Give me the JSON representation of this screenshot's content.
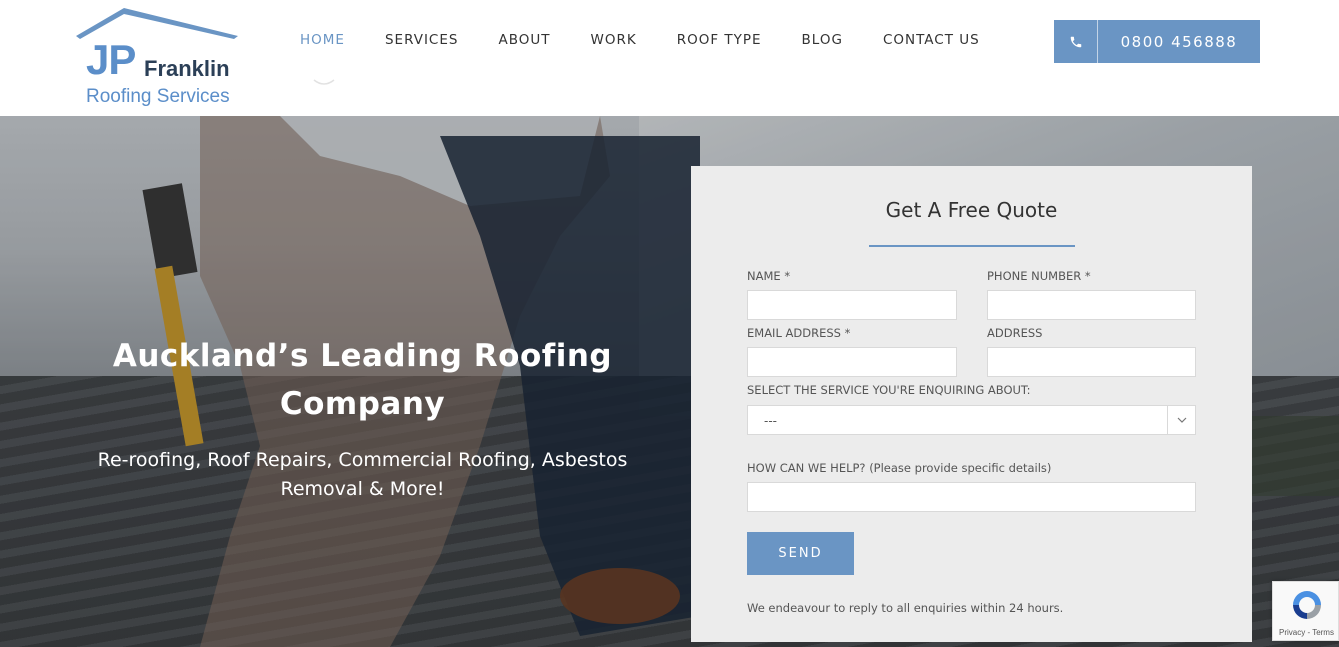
{
  "brand": {
    "logo_initials": "JP",
    "logo_name": "Franklin",
    "logo_tagline": "Roofing Services",
    "accent_color": "#6a95c4",
    "dark_color": "#2b3f57"
  },
  "nav": {
    "items": [
      {
        "label": "HOME",
        "active": true
      },
      {
        "label": "SERVICES",
        "active": false
      },
      {
        "label": "ABOUT",
        "active": false
      },
      {
        "label": "WORK",
        "active": false
      },
      {
        "label": "ROOF TYPE",
        "active": false
      },
      {
        "label": "BLOG",
        "active": false
      },
      {
        "label": "CONTACT US",
        "active": false
      }
    ],
    "phone_icon": "phone-icon",
    "phone_number": "0800 456888"
  },
  "hero": {
    "title": "Auckland’s Leading Roofing Company",
    "subtitle": "Re-roofing, Roof Repairs, Commercial Roofing, Asbestos Removal & More!"
  },
  "quote_form": {
    "title": "Get A Free Quote",
    "name_label": "NAME *",
    "phone_label": "PHONE NUMBER *",
    "email_label": "EMAIL ADDRESS *",
    "address_label": "ADDRESS",
    "service_label": "SELECT THE SERVICE YOU'RE ENQUIRING ABOUT:",
    "service_selected": "---",
    "help_label": "HOW CAN WE HELP? (Please provide specific details)",
    "name_value": "",
    "phone_value": "",
    "email_value": "",
    "address_value": "",
    "help_value": "",
    "send_label": "SEND",
    "note": "We endeavour to reply to all enquiries within 24 hours."
  },
  "recaptcha": {
    "text": "Privacy - Terms"
  }
}
